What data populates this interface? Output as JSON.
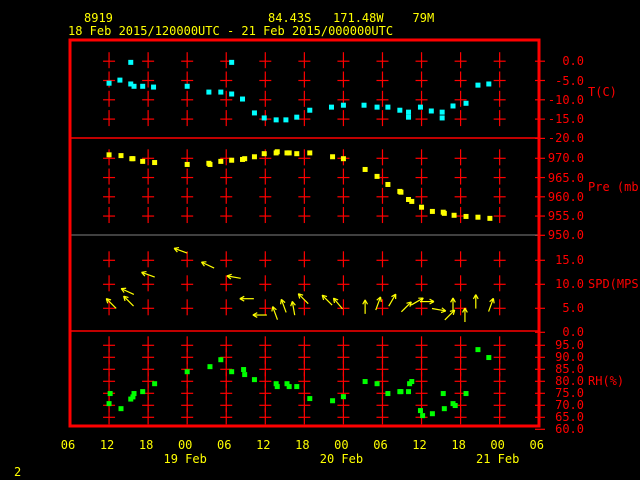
{
  "header": {
    "station": "8919",
    "location": "84.43S   171.48W    79M",
    "period": "18 Feb 2015/120000UTC - 21 Feb 2015/000000UTC"
  },
  "footer": {
    "page": "2"
  },
  "colors": {
    "frame": "#ff0000",
    "axis_text": "#ff0000",
    "time_text": "#ffff00",
    "temperature": "#00ffff",
    "pressure": "#ffff00",
    "wind": "#ffff00",
    "rh": "#00ff00",
    "separator_grey": "#808080"
  },
  "chart_data": [
    {
      "type": "scatter",
      "ylabel": "T(C)",
      "yticks": [
        "0.0",
        "-5.0",
        "-10.0",
        "-15.0",
        "-20.0"
      ],
      "ylim": [
        -20,
        5.4
      ],
      "points": [
        [
          "2015-02-18 12:00",
          -5.7
        ],
        [
          "2015-02-18 13:40",
          -4.9
        ],
        [
          "2015-02-18 15:20",
          -0.3
        ],
        [
          "2015-02-18 15:20",
          -5.9
        ],
        [
          "2015-02-18 15:50",
          -6.5
        ],
        [
          "2015-02-18 17:10",
          -6.5
        ],
        [
          "2015-02-18 18:50",
          -6.7
        ],
        [
          "2015-02-19 00:00",
          -6.5
        ],
        [
          "2015-02-19 03:20",
          -8.0
        ],
        [
          "2015-02-19 05:10",
          -8.0
        ],
        [
          "2015-02-19 06:50",
          -0.3
        ],
        [
          "2015-02-19 06:50",
          -8.5
        ],
        [
          "2015-02-19 08:30",
          -9.8
        ],
        [
          "2015-02-19 10:20",
          -13.4
        ],
        [
          "2015-02-19 11:50",
          -14.7
        ],
        [
          "2015-02-19 13:40",
          -15.2
        ],
        [
          "2015-02-19 15:10",
          -15.2
        ],
        [
          "2015-02-19 16:50",
          -14.5
        ],
        [
          "2015-02-19 18:50",
          -12.7
        ],
        [
          "2015-02-19 22:10",
          -11.9
        ],
        [
          "2015-02-20 00:00",
          -11.4
        ],
        [
          "2015-02-20 03:10",
          -11.4
        ],
        [
          "2015-02-20 05:10",
          -11.9
        ],
        [
          "2015-02-20 06:50",
          -11.9
        ],
        [
          "2015-02-20 08:40",
          -12.7
        ],
        [
          "2015-02-20 10:00",
          -13.2
        ],
        [
          "2015-02-20 10:00",
          -14.5
        ],
        [
          "2015-02-20 11:50",
          -11.9
        ],
        [
          "2015-02-20 13:30",
          -12.9
        ],
        [
          "2015-02-20 15:10",
          -13.2
        ],
        [
          "2015-02-20 15:10",
          -14.7
        ],
        [
          "2015-02-20 16:50",
          -11.6
        ],
        [
          "2015-02-20 18:50",
          -10.9
        ],
        [
          "2015-02-20 20:40",
          -6.2
        ],
        [
          "2015-02-20 22:20",
          -5.9
        ]
      ]
    },
    {
      "type": "scatter",
      "ylabel": "Pre (mb)",
      "yticks": [
        "970.0",
        "965.0",
        "960.0",
        "955.0",
        "950.0"
      ],
      "ylim": [
        950,
        975.4
      ],
      "points": [
        [
          "2015-02-18 12:00",
          970.9
        ],
        [
          "2015-02-18 13:50",
          970.7
        ],
        [
          "2015-02-18 15:30",
          969.9
        ],
        [
          "2015-02-18 15:40",
          969.9
        ],
        [
          "2015-02-18 17:10",
          969.2
        ],
        [
          "2015-02-18 19:00",
          968.9
        ],
        [
          "2015-02-19 00:00",
          968.4
        ],
        [
          "2015-02-19 03:20",
          968.7
        ],
        [
          "2015-02-19 03:30",
          968.4
        ],
        [
          "2015-02-19 05:10",
          969.2
        ],
        [
          "2015-02-19 06:50",
          969.5
        ],
        [
          "2015-02-19 08:30",
          969.7
        ],
        [
          "2015-02-19 08:50",
          969.9
        ],
        [
          "2015-02-19 10:20",
          970.4
        ],
        [
          "2015-02-19 11:50",
          971.2
        ],
        [
          "2015-02-19 13:40",
          971.4
        ],
        [
          "2015-02-19 13:50",
          971.7
        ],
        [
          "2015-02-19 15:20",
          971.4
        ],
        [
          "2015-02-19 15:40",
          971.4
        ],
        [
          "2015-02-19 16:50",
          971.2
        ],
        [
          "2015-02-19 18:50",
          971.4
        ],
        [
          "2015-02-19 22:20",
          970.4
        ],
        [
          "2015-02-20 00:00",
          969.9
        ],
        [
          "2015-02-20 03:20",
          967.1
        ],
        [
          "2015-02-20 05:10",
          965.3
        ],
        [
          "2015-02-20 06:50",
          963.2
        ],
        [
          "2015-02-20 08:40",
          961.4
        ],
        [
          "2015-02-20 08:50",
          961.2
        ],
        [
          "2015-02-20 10:00",
          959.3
        ],
        [
          "2015-02-20 10:30",
          958.8
        ],
        [
          "2015-02-20 12:00",
          957.3
        ],
        [
          "2015-02-20 13:40",
          956.2
        ],
        [
          "2015-02-20 15:20",
          956.0
        ],
        [
          "2015-02-20 15:30",
          955.7
        ],
        [
          "2015-02-20 17:00",
          955.2
        ],
        [
          "2015-02-20 18:50",
          954.9
        ],
        [
          "2015-02-20 20:40",
          954.7
        ],
        [
          "2015-02-20 22:30",
          954.4
        ]
      ]
    },
    {
      "type": "scatter",
      "ylabel": "SPD(MPS)",
      "yticks": [
        "15.0",
        "10.0",
        "5.0",
        "0.0"
      ],
      "ylim": [
        0,
        20
      ],
      "marker": "wind-arrow (direction toward, degrees)",
      "points": [
        [
          "2015-02-18 12:20",
          6.0,
          315
        ],
        [
          "2015-02-18 14:50",
          8.5,
          295
        ],
        [
          "2015-02-18 15:00",
          6.5,
          315
        ],
        [
          "2015-02-18 18:00",
          12.0,
          290
        ],
        [
          "2015-02-18 23:00",
          17.0,
          290
        ],
        [
          "2015-02-19 03:10",
          14.0,
          295
        ],
        [
          "2015-02-19 07:10",
          11.5,
          280
        ],
        [
          "2015-02-19 09:10",
          7.0,
          270
        ],
        [
          "2015-02-19 11:10",
          3.6,
          270
        ],
        [
          "2015-02-19 13:30",
          4.0,
          340
        ],
        [
          "2015-02-19 14:50",
          5.5,
          340
        ],
        [
          "2015-02-19 16:20",
          5.0,
          350
        ],
        [
          "2015-02-19 17:50",
          7.0,
          315
        ],
        [
          "2015-02-19 21:30",
          6.7,
          315
        ],
        [
          "2015-02-19 23:10",
          6.0,
          320
        ],
        [
          "2015-02-20 03:20",
          5.3,
          0
        ],
        [
          "2015-02-20 05:20",
          6.0,
          20
        ],
        [
          "2015-02-20 07:30",
          6.7,
          30
        ],
        [
          "2015-02-20 09:40",
          5.3,
          45
        ],
        [
          "2015-02-20 11:20",
          6.4,
          60
        ],
        [
          "2015-02-20 12:50",
          6.4,
          90
        ],
        [
          "2015-02-20 14:40",
          4.7,
          100
        ],
        [
          "2015-02-20 16:20",
          3.6,
          45
        ],
        [
          "2015-02-20 16:50",
          5.7,
          0
        ],
        [
          "2015-02-20 18:40",
          3.6,
          0
        ],
        [
          "2015-02-20 20:20",
          6.4,
          0
        ],
        [
          "2015-02-20 22:40",
          5.7,
          20
        ]
      ]
    },
    {
      "type": "scatter",
      "ylabel": "RH(%)",
      "yticks": [
        "95.0",
        "90.0",
        "85.0",
        "80.0",
        "75.0",
        "70.0",
        "65.0",
        "60.0"
      ],
      "ylim": [
        61,
        101
      ],
      "points": [
        [
          "2015-02-18 12:00",
          70.7
        ],
        [
          "2015-02-18 12:10",
          74.9
        ],
        [
          "2015-02-18 13:50",
          68.6
        ],
        [
          "2015-02-18 15:20",
          72.6
        ],
        [
          "2015-02-18 15:40",
          73.5
        ],
        [
          "2015-02-18 15:50",
          74.9
        ],
        [
          "2015-02-18 17:10",
          75.7
        ],
        [
          "2015-02-18 19:00",
          79.0
        ],
        [
          "2015-02-19 00:00",
          84.0
        ],
        [
          "2015-02-19 03:30",
          86.1
        ],
        [
          "2015-02-19 05:10",
          89.0
        ],
        [
          "2015-02-19 06:50",
          84.0
        ],
        [
          "2015-02-19 08:40",
          84.9
        ],
        [
          "2015-02-19 08:50",
          82.8
        ],
        [
          "2015-02-19 10:20",
          80.7
        ],
        [
          "2015-02-19 13:40",
          79.0
        ],
        [
          "2015-02-19 13:50",
          77.8
        ],
        [
          "2015-02-19 15:20",
          79.0
        ],
        [
          "2015-02-19 15:40",
          77.8
        ],
        [
          "2015-02-19 16:50",
          77.8
        ],
        [
          "2015-02-19 18:50",
          72.8
        ],
        [
          "2015-02-19 22:20",
          71.9
        ],
        [
          "2015-02-20 00:00",
          73.6
        ],
        [
          "2015-02-20 03:20",
          79.9
        ],
        [
          "2015-02-20 05:10",
          79.0
        ],
        [
          "2015-02-20 06:50",
          74.9
        ],
        [
          "2015-02-20 08:40",
          75.7
        ],
        [
          "2015-02-20 08:50",
          75.7
        ],
        [
          "2015-02-20 10:00",
          75.7
        ],
        [
          "2015-02-20 10:10",
          79.0
        ],
        [
          "2015-02-20 10:30",
          79.9
        ],
        [
          "2015-02-20 11:50",
          67.8
        ],
        [
          "2015-02-20 12:10",
          65.7
        ],
        [
          "2015-02-20 13:40",
          66.5
        ],
        [
          "2015-02-20 15:20",
          74.9
        ],
        [
          "2015-02-20 15:30",
          68.6
        ],
        [
          "2015-02-20 16:50",
          70.7
        ],
        [
          "2015-02-20 17:10",
          69.9
        ],
        [
          "2015-02-20 18:50",
          74.9
        ],
        [
          "2015-02-20 20:40",
          93.2
        ],
        [
          "2015-02-20 22:20",
          89.9
        ]
      ]
    }
  ],
  "time_axis": {
    "xlim": [
      "2015-02-18 06:00",
      "2015-02-21 06:00"
    ],
    "hour_labels": [
      "06",
      "12",
      "18",
      "00",
      "06",
      "12",
      "18",
      "00",
      "06",
      "12",
      "18",
      "00",
      "06"
    ],
    "date_labels": [
      "19 Feb",
      "20 Feb",
      "21 Feb"
    ]
  }
}
